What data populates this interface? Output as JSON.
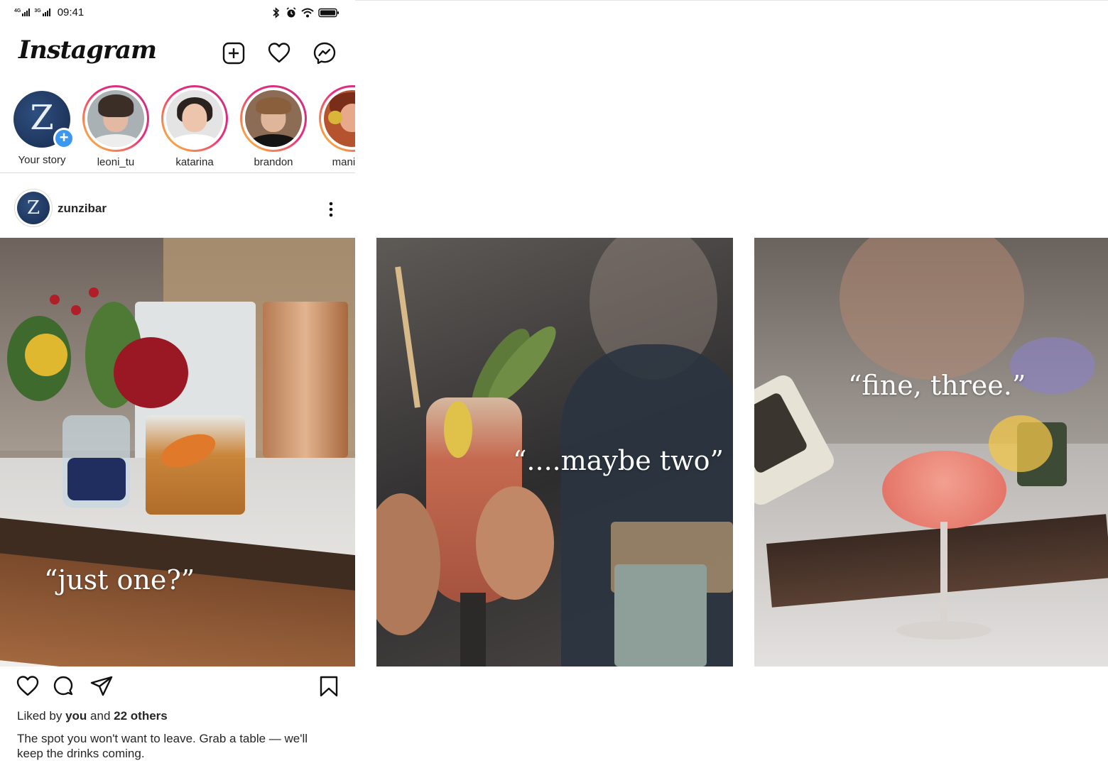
{
  "status_bar": {
    "net1": "4G",
    "net2": "3G",
    "time": "09:41",
    "icons": [
      "bluetooth-icon",
      "alarm-icon",
      "wifi-icon",
      "battery-icon"
    ]
  },
  "header": {
    "logo": "Instagram",
    "icons": [
      "new-post-icon",
      "heart-icon",
      "messenger-icon"
    ]
  },
  "stories": [
    {
      "label": "Your story",
      "own": true
    },
    {
      "label": "leoni_tu"
    },
    {
      "label": "katarina"
    },
    {
      "label": "brandon"
    },
    {
      "label": "manisha"
    }
  ],
  "post": {
    "username": "zunzibar",
    "avatar_letter": "Z",
    "slides": [
      {
        "quote": "“just one?”"
      },
      {
        "quote": "“....maybe two”"
      },
      {
        "quote": "“fine, three.”"
      }
    ],
    "likes": {
      "prefix": "Liked by",
      "you": "you",
      "and": "and",
      "others": "22 others"
    },
    "caption": "The spot you won't want to leave. Grab a table — we'll keep the drinks coming."
  },
  "colors": {
    "accent_blue": "#3b97f0",
    "story_ring_start": "#f9ce34",
    "story_ring_end": "#c13584",
    "text": "#262626"
  }
}
